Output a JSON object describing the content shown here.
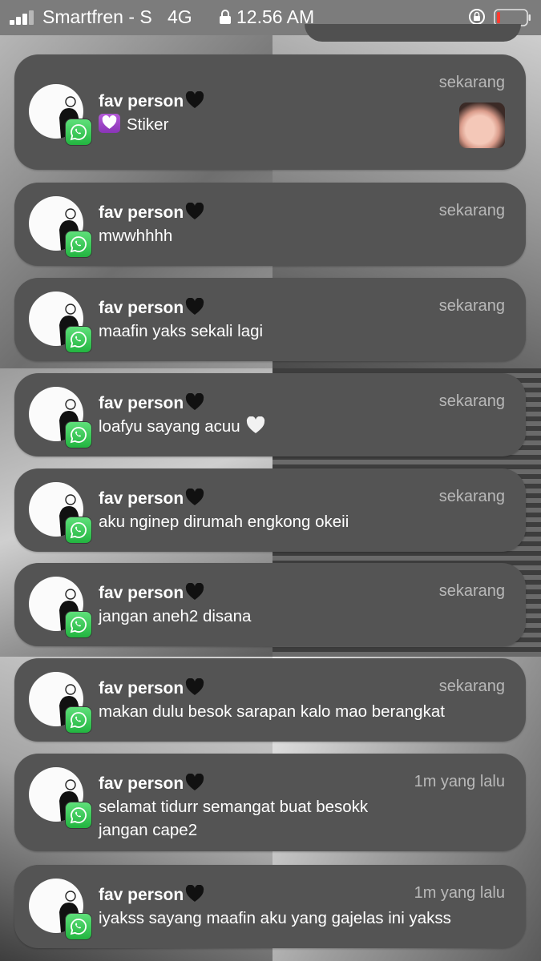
{
  "status_bar": {
    "carrier": "Smartfren - S",
    "network": "4G",
    "time": "12.56 AM"
  },
  "colors": {
    "card_bg": "#545454",
    "whatsapp_green": "#25d366",
    "battery_low": "#ff3b30",
    "timestamp_text": "#b9b9b9"
  },
  "icons": {
    "heart_black": "black-heart-icon",
    "heart_white": "white-heart-icon",
    "sticker": "heart-box-icon",
    "app": "whatsapp-icon"
  },
  "notifications": [
    {
      "sender": "fav person",
      "time": "sekarang",
      "message": "Stiker"
    },
    {
      "sender": "fav person",
      "time": "sekarang",
      "message": "mwwhhhh"
    },
    {
      "sender": "fav person",
      "time": "sekarang",
      "message": "maafin yaks sekali lagi"
    },
    {
      "sender": "fav person",
      "time": "sekarang",
      "message": "loafyu sayang acuu"
    },
    {
      "sender": "fav person",
      "time": "sekarang",
      "message": "aku nginep dirumah engkong okeii"
    },
    {
      "sender": "fav person",
      "time": "sekarang",
      "message": "jangan aneh2 disana"
    },
    {
      "sender": "fav person",
      "time": "sekarang",
      "message": "makan dulu besok sarapan kalo mao berangkat"
    },
    {
      "sender": "fav person",
      "time": "1m yang lalu",
      "message": "selamat tidurr semangat buat besokk\njangan cape2"
    },
    {
      "sender": "fav person",
      "time": "1m yang lalu",
      "message": "iyakss sayang maafin aku yang gajelas ini yakss"
    }
  ]
}
